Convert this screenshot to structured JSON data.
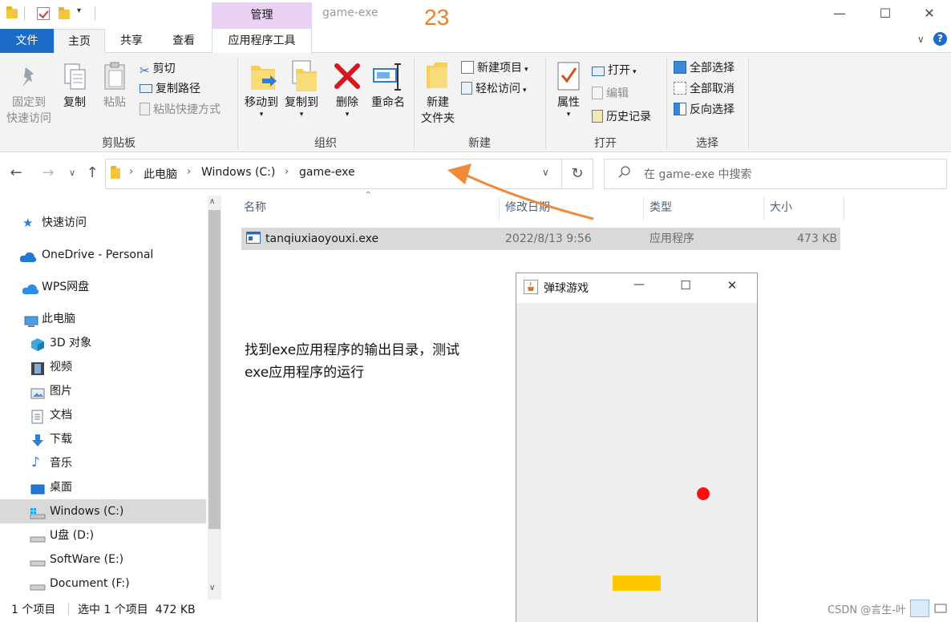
{
  "window": {
    "title": "game-exe",
    "annotation_number": "23",
    "manage_tab": "管理",
    "minimize": "—",
    "maximize": "☐",
    "close": "✕"
  },
  "ribbon_tabs": [
    "文件",
    "主页",
    "共享",
    "查看",
    "应用程序工具"
  ],
  "ribbon": {
    "clipboard": {
      "pin_line1": "固定到",
      "pin_line2": "快速访问",
      "copy": "复制",
      "paste": "粘贴",
      "cut": "剪切",
      "copy_path": "复制路径",
      "paste_shortcut": "粘贴快捷方式",
      "label": "剪贴板"
    },
    "organize": {
      "move_to": "移动到",
      "copy_to": "复制到",
      "delete": "删除",
      "rename": "重命名",
      "label": "组织"
    },
    "new": {
      "new_folder_line1": "新建",
      "new_folder_line2": "文件夹",
      "new_item": "新建项目",
      "easy_access": "轻松访问",
      "label": "新建"
    },
    "open": {
      "properties": "属性",
      "open": "打开",
      "edit": "编辑",
      "history": "历史记录",
      "label": "打开"
    },
    "select": {
      "select_all": "全部选择",
      "select_none": "全部取消",
      "invert": "反向选择",
      "label": "选择"
    }
  },
  "address": {
    "crumbs": [
      "此电脑",
      "Windows (C:)",
      "game-exe"
    ],
    "search_placeholder": "在 game-exe 中搜索"
  },
  "nav_pane": {
    "items": [
      {
        "label": "快速访问",
        "icon": "star-icon"
      },
      {
        "label": "OneDrive - Personal",
        "icon": "cloud-icon"
      },
      {
        "label": "WPS网盘",
        "icon": "wps-cloud-icon"
      },
      {
        "label": "此电脑",
        "icon": "pc-icon"
      },
      {
        "label": "3D 对象",
        "icon": "cube-icon"
      },
      {
        "label": "视频",
        "icon": "film-icon"
      },
      {
        "label": "图片",
        "icon": "picture-icon"
      },
      {
        "label": "文档",
        "icon": "document-icon"
      },
      {
        "label": "下载",
        "icon": "download-icon"
      },
      {
        "label": "音乐",
        "icon": "music-icon"
      },
      {
        "label": "桌面",
        "icon": "desktop-icon"
      },
      {
        "label": "Windows (C:)",
        "icon": "drive-icon"
      },
      {
        "label": "U盘 (D:)",
        "icon": "drive-icon"
      },
      {
        "label": "SoftWare (E:)",
        "icon": "drive-icon"
      },
      {
        "label": "Document (F:)",
        "icon": "drive-icon"
      }
    ]
  },
  "file_list": {
    "columns": [
      "名称",
      "修改日期",
      "类型",
      "大小"
    ],
    "rows": [
      {
        "name": "tanqiuxiaoyouxi.exe",
        "modified": "2022/8/13 9:56",
        "type": "应用程序",
        "size": "473 KB"
      }
    ]
  },
  "status_bar": {
    "count": "1 个项目",
    "selected": "选中 1 个项目  472 KB"
  },
  "game_window": {
    "title": "弹球游戏",
    "minimize": "—",
    "maximize": "☐",
    "close": "✕",
    "ball_color": "#ff1010",
    "paddle_color": "#ffc800"
  },
  "annotation": {
    "line1": "找到exe应用程序的输出目录，测试",
    "line2": "exe应用程序的运行",
    "arrow_color": "#ee8a3a"
  },
  "watermark": "CSDN @言生-叶"
}
